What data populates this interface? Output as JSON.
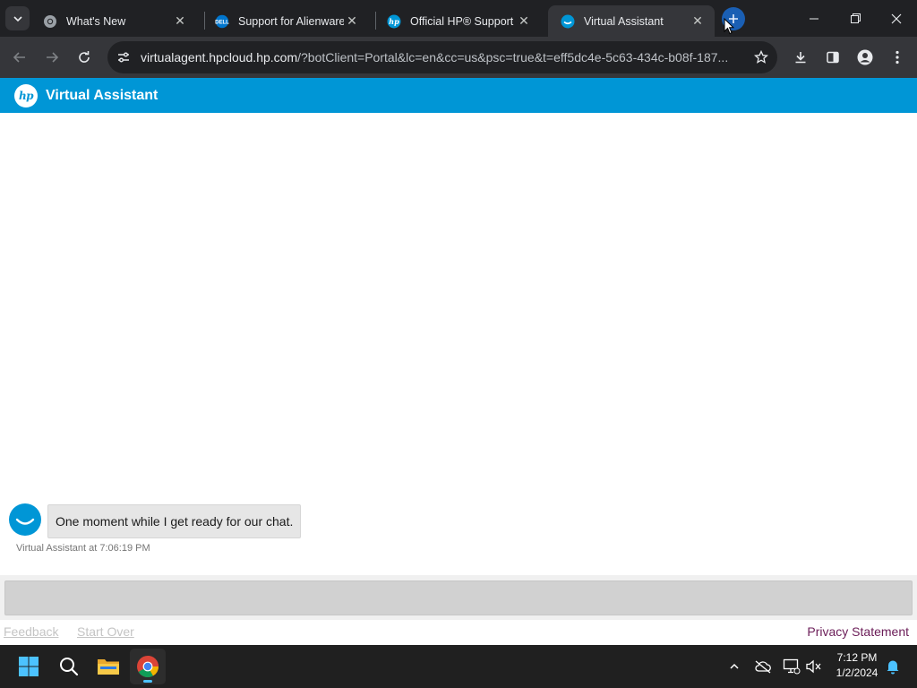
{
  "browser": {
    "tabs": [
      {
        "title": "What's New",
        "favicon": "chrome-icon",
        "active": false
      },
      {
        "title": "Support for Alienware",
        "favicon": "dell-icon",
        "active": false
      },
      {
        "title": "Official HP® Support",
        "favicon": "hp-icon",
        "active": false
      },
      {
        "title": "Virtual Assistant",
        "favicon": "virtual-assistant-icon",
        "active": true
      }
    ],
    "url_host": "virtualagent.hpcloud.hp.com",
    "url_path": "/?botClient=Portal&lc=en&cc=us&psc=true&t=eff5dc4e-5c63-434c-b08f-187..."
  },
  "header": {
    "logo_text": "hp",
    "title": "Virtual Assistant"
  },
  "chat": {
    "messages": [
      {
        "text": "One moment while I get ready for our chat.",
        "sender": "Virtual Assistant",
        "time": "7:06:19 PM"
      }
    ],
    "meta_at": "at"
  },
  "footer": {
    "feedback": "Feedback",
    "start_over": "Start Over",
    "privacy": "Privacy Statement"
  },
  "taskbar": {
    "time": "7:12 PM",
    "date": "1/2/2024"
  },
  "colors": {
    "hp_blue": "#0096d6",
    "tab_strip": "#202124",
    "toolbar": "#35363a",
    "privacy_link": "#6b1d58"
  }
}
